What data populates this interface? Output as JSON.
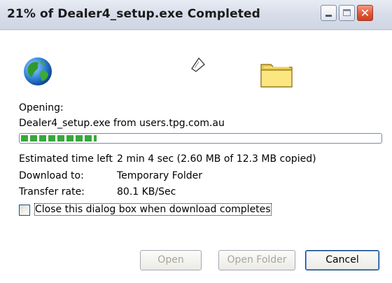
{
  "window": {
    "title": "21% of Dealer4_setup.exe Completed",
    "close_glyph": "✕"
  },
  "icons": [
    "globe-icon",
    "flying-paper-icon",
    "folder-icon"
  ],
  "status": {
    "opening_label": "Opening:",
    "file_source": "Dealer4_setup.exe from users.tpg.com.au"
  },
  "progress": {
    "fraction": 0.21
  },
  "details": {
    "time_left_label": "Estimated time left",
    "time_left_value": "2 min 4 sec (2.60 MB of 12.3 MB copied)",
    "download_to_label": "Download to:",
    "download_to_value": "Temporary Folder",
    "transfer_rate_label": "Transfer rate:",
    "transfer_rate_value": "80.1 KB/Sec"
  },
  "checkbox": {
    "label": "Close this dialog box when download completes",
    "checked": false
  },
  "buttons": {
    "open": "Open",
    "open_folder": "Open Folder",
    "cancel": "Cancel"
  },
  "colors": {
    "progress_fill": "#37a83b",
    "disabled_text": "#a7a69b",
    "close_button": "#e0583a"
  }
}
